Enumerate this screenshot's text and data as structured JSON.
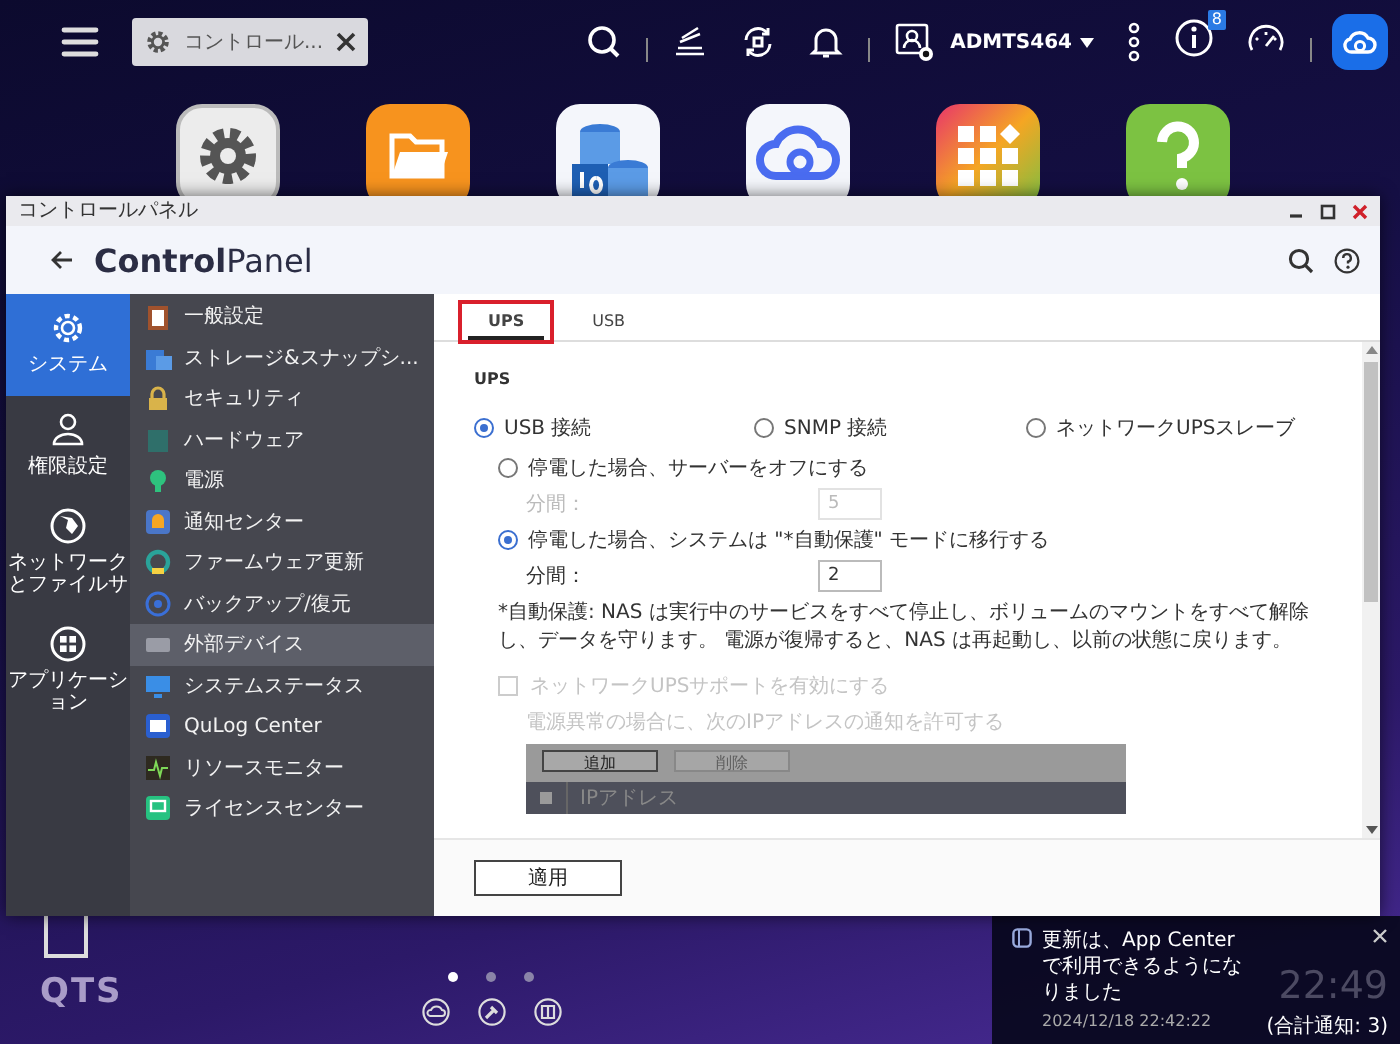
{
  "top_bar": {
    "tab": {
      "label": "コントロール..."
    },
    "user": {
      "name": "ADMTS464"
    },
    "info_badge": "8"
  },
  "window": {
    "title": "コントロールパネル",
    "app_title": "**Control**Panel",
    "rail": [
      {
        "label": "システム",
        "selected": true
      },
      {
        "label": "権限設定",
        "selected": false
      },
      {
        "label": "ネットワークとファイルサ",
        "selected": false
      },
      {
        "label": "アプリケーション",
        "selected": false
      }
    ],
    "menu": [
      {
        "label": "一般設定",
        "selected": false
      },
      {
        "label": "ストレージ&スナップシ...",
        "selected": false
      },
      {
        "label": "セキュリティ",
        "selected": false
      },
      {
        "label": "ハードウェア",
        "selected": false
      },
      {
        "label": "電源",
        "selected": false
      },
      {
        "label": "通知センター",
        "selected": false
      },
      {
        "label": "ファームウェア更新",
        "selected": false
      },
      {
        "label": "バックアップ/復元",
        "selected": false
      },
      {
        "label": "外部デバイス",
        "selected": true
      },
      {
        "label": "システムステータス",
        "selected": false
      },
      {
        "label": "QuLog Center",
        "selected": false
      },
      {
        "label": "リソースモニター",
        "selected": false
      },
      {
        "label": "ライセンスセンター",
        "selected": false
      }
    ],
    "tabs": [
      {
        "label": "UPS",
        "selected": true,
        "highlighted": true
      },
      {
        "label": "USB",
        "selected": false,
        "highlighted": false
      }
    ],
    "section_title": "UPS",
    "connection_options": [
      {
        "label": "USB 接続",
        "selected": true
      },
      {
        "label": "SNMP 接続",
        "selected": false
      },
      {
        "label": "ネットワークUPSスレーブ",
        "selected": false
      }
    ],
    "power_options": [
      {
        "label": "停電した場合、サーバーをオフにする",
        "selected": false,
        "minutes_label": "分間：",
        "minutes": "5"
      },
      {
        "label": "停電した場合、システムは \"*自動保護\" モードに移行する",
        "selected": true,
        "minutes_label": "分間：",
        "minutes": "2"
      }
    ],
    "note": "*自動保護: NAS は実行中のサービスをすべて停止し、ボリュームのマウントをすべて解除し、データを守ります。 電源が復帰すると、NAS は再起動し、以前の状態に戻ります。",
    "network_ups": {
      "label": "ネットワークUPSサポートを有効にする",
      "checked": false,
      "disabled": true,
      "hint": "電源異常の場合に、次のIPアドレスの通知を許可する",
      "buttons": [
        {
          "label": "追加",
          "disabled": false
        },
        {
          "label": "削除",
          "disabled": true
        }
      ],
      "select_all_checked": false,
      "columns": [
        "IPアドレス"
      ]
    },
    "apply_button": "適用"
  },
  "desktop": {
    "logo": "QTS",
    "page_dots": [
      {
        "selected": true
      },
      {
        "selected": false
      },
      {
        "selected": false
      }
    ],
    "clock": "22:49"
  },
  "notification": {
    "message": "更新は、App Center で利用できるようになりました",
    "time": "2024/12/18 22:42:22",
    "total": "(合計通知: 3)"
  }
}
